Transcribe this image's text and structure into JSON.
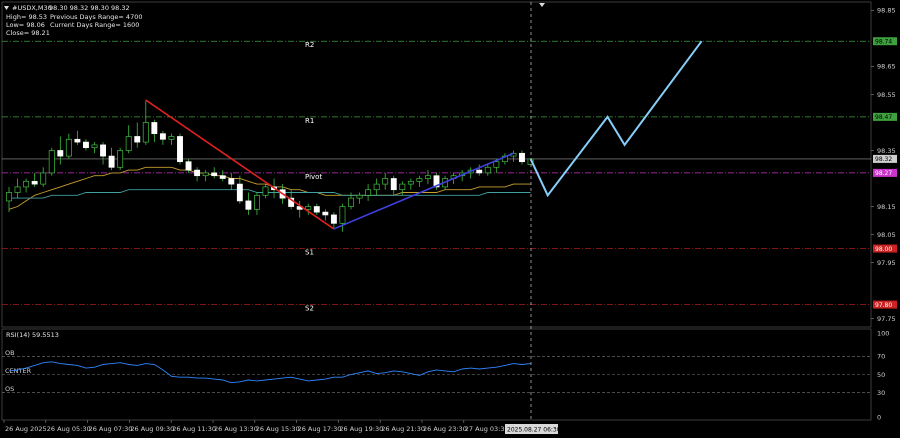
{
  "window": {
    "title_symbol": "#USDX,M30",
    "ohlc_line": "98.30 98.32 98.30 98.32",
    "high_label": "High= 98.53",
    "low_label": "Low= 98.06",
    "close_label": "Close= 98.21",
    "prev_range_label": "Previous Days Range= 4700",
    "curr_range_label": "Current Days Range= 1600"
  },
  "levels": [
    {
      "name": "R2",
      "price": 98.74,
      "tag": "98.74",
      "color": "#3fa03f",
      "tag_bg": "#3fa03f",
      "tag_fg": "#000000"
    },
    {
      "name": "R1",
      "price": 98.47,
      "tag": "98.47",
      "color": "#3fa03f",
      "tag_bg": "#3fa03f",
      "tag_fg": "#000000"
    },
    {
      "name": "Pivot",
      "price": 98.27,
      "tag": "98.27",
      "color": "#cc33cc",
      "tag_bg": "#cc33cc",
      "tag_fg": "#ffffff"
    },
    {
      "name": "S1",
      "price": 98.0,
      "tag": "98.00",
      "color": "#cc2222",
      "tag_bg": "#cc2222",
      "tag_fg": "#ffffff"
    },
    {
      "name": "S2",
      "price": 97.8,
      "tag": "97.80",
      "color": "#cc2222",
      "tag_bg": "#cc2222",
      "tag_fg": "#ffffff"
    }
  ],
  "current_price": {
    "price": 98.32,
    "tag": "98.32"
  },
  "price_axis": {
    "ticks": [
      "98.85",
      "98.65",
      "98.55",
      "98.35",
      "98.15",
      "98.05",
      "97.95",
      "97.75"
    ]
  },
  "time_axis": {
    "labels": [
      "26 Aug 2025",
      "26 Aug 05:30",
      "26 Aug 07:30",
      "26 Aug 09:30",
      "26 Aug 11:30",
      "26 Aug 13:30",
      "26 Aug 15:30",
      "26 Aug 17:30",
      "26 Aug 19:30",
      "26 Aug 21:30",
      "26 Aug 23:30",
      "27 Aug 03:30"
    ],
    "cursor_label": "2025.08.27 06:30"
  },
  "rsi": {
    "label": "RSI(14) 59.5513",
    "levels_text": [
      "OB",
      "CENTER",
      "OS"
    ],
    "ticks": [
      "100",
      "70",
      "50",
      "30",
      "0"
    ],
    "values": [
      54,
      55,
      57,
      60,
      63,
      64,
      62,
      61,
      60,
      57,
      58,
      61,
      62,
      63,
      61,
      60,
      62,
      61,
      55,
      48,
      47,
      47,
      46,
      46,
      45,
      44,
      41,
      42,
      44,
      43,
      44,
      45,
      46,
      47,
      45,
      43,
      44,
      45,
      47,
      47,
      50,
      52,
      54,
      51,
      52,
      54,
      53,
      51,
      49,
      53,
      55,
      54,
      53,
      56,
      57,
      56,
      57,
      58,
      60,
      62,
      61,
      62
    ],
    "color": "#2f86ff"
  },
  "chart_data": {
    "type": "candlestick",
    "symbol": "#USDX,M30",
    "ylim": [
      97.72,
      98.88
    ],
    "candles": [
      [
        98.17,
        98.22,
        98.13,
        98.2
      ],
      [
        98.2,
        98.25,
        98.18,
        98.22
      ],
      [
        98.22,
        98.25,
        98.2,
        98.24
      ],
      [
        98.24,
        98.27,
        98.22,
        98.23
      ],
      [
        98.23,
        98.29,
        98.22,
        98.27
      ],
      [
        98.27,
        98.36,
        98.26,
        98.35
      ],
      [
        98.35,
        98.4,
        98.3,
        98.33
      ],
      [
        98.33,
        98.41,
        98.32,
        98.39
      ],
      [
        98.39,
        98.42,
        98.37,
        98.38
      ],
      [
        98.38,
        98.39,
        98.35,
        98.36
      ],
      [
        98.36,
        98.38,
        98.34,
        98.37
      ],
      [
        98.37,
        98.38,
        98.3,
        98.33
      ],
      [
        98.33,
        98.36,
        98.28,
        98.29
      ],
      [
        98.29,
        98.36,
        98.28,
        98.35
      ],
      [
        98.35,
        98.44,
        98.34,
        98.4
      ],
      [
        98.4,
        98.45,
        98.36,
        98.38
      ],
      [
        98.38,
        98.53,
        98.37,
        98.45
      ],
      [
        98.45,
        98.46,
        98.38,
        98.41
      ],
      [
        98.41,
        98.42,
        98.37,
        98.39
      ],
      [
        98.39,
        98.41,
        98.37,
        98.4
      ],
      [
        98.4,
        98.41,
        98.3,
        98.31
      ],
      [
        98.31,
        98.32,
        98.27,
        98.28
      ],
      [
        98.28,
        98.29,
        98.24,
        98.26
      ],
      [
        98.26,
        98.28,
        98.24,
        98.27
      ],
      [
        98.27,
        98.29,
        98.25,
        98.26
      ],
      [
        98.26,
        98.28,
        98.24,
        98.25
      ],
      [
        98.25,
        98.27,
        98.21,
        98.23
      ],
      [
        98.23,
        98.26,
        98.16,
        98.17
      ],
      [
        98.17,
        98.2,
        98.12,
        98.14
      ],
      [
        98.14,
        98.2,
        98.12,
        98.19
      ],
      [
        98.19,
        98.23,
        98.18,
        98.22
      ],
      [
        98.22,
        98.25,
        98.18,
        98.21
      ],
      [
        98.21,
        98.23,
        98.16,
        98.18
      ],
      [
        98.18,
        98.21,
        98.14,
        98.15
      ],
      [
        98.15,
        98.17,
        98.11,
        98.14
      ],
      [
        98.14,
        98.16,
        98.12,
        98.15
      ],
      [
        98.15,
        98.16,
        98.12,
        98.13
      ],
      [
        98.13,
        98.14,
        98.1,
        98.12
      ],
      [
        98.12,
        98.13,
        98.07,
        98.09
      ],
      [
        98.09,
        98.16,
        98.06,
        98.15
      ],
      [
        98.15,
        98.2,
        98.14,
        98.18
      ],
      [
        98.18,
        98.2,
        98.16,
        98.19
      ],
      [
        98.19,
        98.23,
        98.17,
        98.21
      ],
      [
        98.21,
        98.25,
        98.19,
        98.23
      ],
      [
        98.23,
        98.27,
        98.21,
        98.25
      ],
      [
        98.25,
        98.26,
        98.19,
        98.21
      ],
      [
        98.21,
        98.24,
        98.19,
        98.23
      ],
      [
        98.23,
        98.25,
        98.21,
        98.24
      ],
      [
        98.24,
        98.26,
        98.22,
        98.25
      ],
      [
        98.25,
        98.28,
        98.23,
        98.26
      ],
      [
        98.26,
        98.27,
        98.21,
        98.22
      ],
      [
        98.22,
        98.26,
        98.21,
        98.25
      ],
      [
        98.25,
        98.27,
        98.23,
        98.26
      ],
      [
        98.26,
        98.28,
        98.24,
        98.27
      ],
      [
        98.27,
        98.29,
        98.25,
        98.28
      ],
      [
        98.28,
        98.3,
        98.26,
        98.27
      ],
      [
        98.27,
        98.3,
        98.26,
        98.29
      ],
      [
        98.29,
        98.32,
        98.27,
        98.31
      ],
      [
        98.31,
        98.34,
        98.3,
        98.33
      ],
      [
        98.33,
        98.35,
        98.31,
        98.34
      ],
      [
        98.34,
        98.35,
        98.3,
        98.31
      ],
      [
        98.3,
        98.32,
        98.3,
        98.32
      ]
    ],
    "ma_fast": [
      98.14,
      98.15,
      98.17,
      98.19,
      98.2,
      98.21,
      98.22,
      98.23,
      98.24,
      98.25,
      98.26,
      98.26,
      98.27,
      98.27,
      98.28,
      98.28,
      98.29,
      98.29,
      98.29,
      98.29,
      98.28,
      98.28,
      98.27,
      98.27,
      98.26,
      98.26,
      98.25,
      98.25,
      98.24,
      98.23,
      98.23,
      98.22,
      98.22,
      98.21,
      98.21,
      98.2,
      98.2,
      98.19,
      98.19,
      98.19,
      98.19,
      98.19,
      98.19,
      98.19,
      98.19,
      98.19,
      98.2,
      98.2,
      98.2,
      98.2,
      98.2,
      98.21,
      98.21,
      98.21,
      98.21,
      98.22,
      98.22,
      98.22,
      98.22,
      98.23,
      98.23,
      98.23
    ],
    "ma_slow": [
      98.18,
      98.18,
      98.18,
      98.18,
      98.18,
      98.19,
      98.19,
      98.19,
      98.19,
      98.2,
      98.2,
      98.2,
      98.2,
      98.2,
      98.21,
      98.21,
      98.21,
      98.21,
      98.21,
      98.21,
      98.21,
      98.21,
      98.21,
      98.21,
      98.21,
      98.21,
      98.21,
      98.21,
      98.21,
      98.2,
      98.2,
      98.2,
      98.2,
      98.2,
      98.2,
      98.2,
      98.2,
      98.2,
      98.2,
      98.19,
      98.19,
      98.19,
      98.19,
      98.19,
      98.19,
      98.19,
      98.19,
      98.19,
      98.19,
      98.19,
      98.19,
      98.19,
      98.19,
      98.19,
      98.19,
      98.19,
      98.2,
      98.2,
      98.2,
      98.2,
      98.2,
      98.2
    ],
    "drawing_down": {
      "from": [
        16,
        98.53
      ],
      "to": [
        38,
        98.07
      ],
      "color": "#e02020"
    },
    "drawing_up": {
      "from": [
        38,
        98.07
      ],
      "to": [
        59,
        98.34
      ],
      "color": "#4040e0"
    },
    "projection": {
      "points": [
        [
          61,
          98.32
        ],
        [
          63,
          98.19
        ],
        [
          70,
          98.47
        ],
        [
          72,
          98.37
        ],
        [
          81,
          98.74
        ]
      ],
      "color": "#87cefa"
    },
    "colors": {
      "bull": "#ffffff",
      "bear": "#ffffff",
      "wick": "#3fbf3f",
      "ma_fast": "#c8a030",
      "ma_slow": "#40a0a0"
    }
  }
}
